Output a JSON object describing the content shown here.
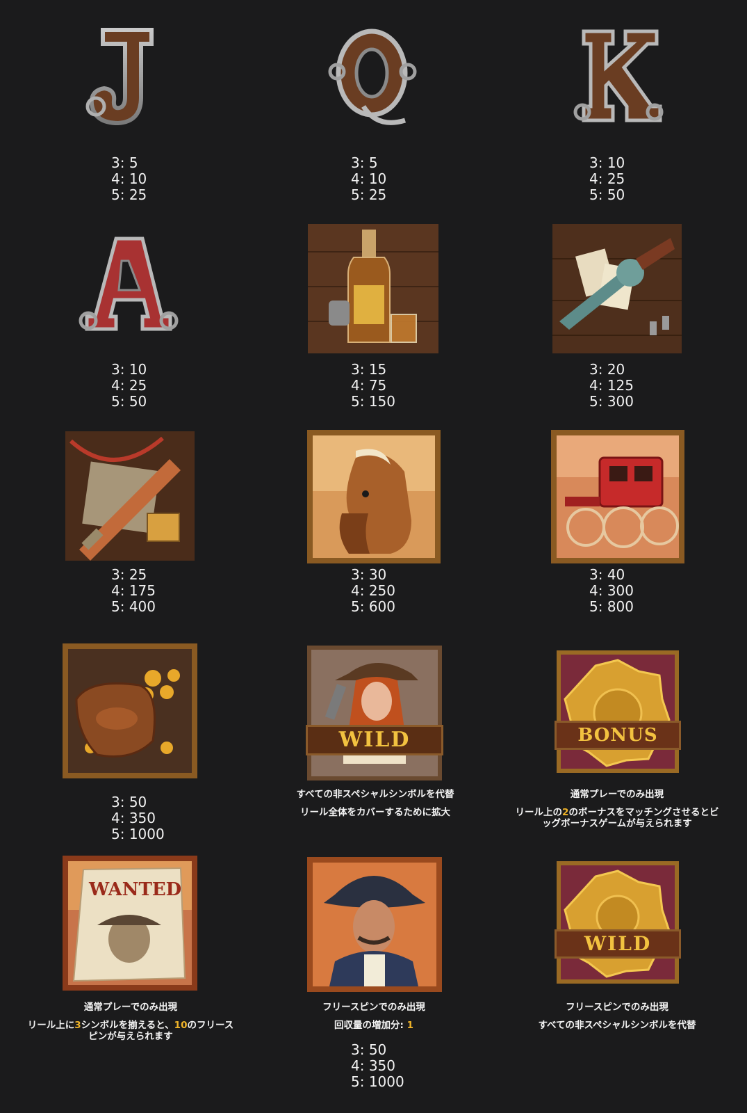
{
  "symbols": [
    {
      "name": "J",
      "payouts": [
        "3: 5",
        "4: 10",
        "5: 25"
      ]
    },
    {
      "name": "Q",
      "payouts": [
        "3: 5",
        "4: 10",
        "5: 25"
      ]
    },
    {
      "name": "K",
      "payouts": [
        "3: 10",
        "4: 25",
        "5: 50"
      ]
    },
    {
      "name": "A",
      "payouts": [
        "3: 10",
        "4: 25",
        "5: 50"
      ]
    },
    {
      "name": "whiskey",
      "payouts": [
        "3: 15",
        "4: 75",
        "5: 150"
      ]
    },
    {
      "name": "revolver",
      "payouts": [
        "3: 20",
        "4: 125",
        "5: 300"
      ]
    },
    {
      "name": "rifle",
      "payouts": [
        "3: 25",
        "4: 175",
        "5: 400"
      ]
    },
    {
      "name": "horse",
      "payouts": [
        "3: 30",
        "4: 250",
        "5: 600"
      ]
    },
    {
      "name": "stagecoach",
      "payouts": [
        "3: 40",
        "4: 300",
        "5: 800"
      ]
    },
    {
      "name": "gold-bag",
      "payouts": [
        "3: 50",
        "4: 350",
        "5: 1000"
      ]
    },
    {
      "name": "wild-woman",
      "label": "WILD",
      "desc": [
        "すべての非スペシャルシンボルを代替",
        "リール全体をカバーするために拡大"
      ]
    },
    {
      "name": "bonus",
      "label": "BONUS",
      "desc1": "通常プレーでのみ出現",
      "desc2_pre": "リール上の",
      "desc2_num": "2",
      "desc2_post": "のボーナスをマッチングさせるとビッグボーナスゲームが与えられます"
    },
    {
      "name": "wanted",
      "label": "WANTED",
      "desc1": "通常プレーでのみ出現",
      "desc2_pre": "リール上に",
      "desc2_num1": "3",
      "desc2_mid": "シンボルを揃えると、",
      "desc2_num2": "10",
      "desc2_post": "のフリースピンが与えられます"
    },
    {
      "name": "sheriff",
      "desc1": "フリースピンでのみ出現",
      "desc2_pre": "回収量の増加分: ",
      "desc2_num": "1",
      "payouts": [
        "3: 50",
        "4: 350",
        "5: 1000"
      ]
    },
    {
      "name": "badge-wild",
      "label": "WILD",
      "desc": [
        "フリースピンでのみ出現",
        "すべての非スペシャルシンボルを代替"
      ]
    }
  ],
  "colors": {
    "highlight": "#f0b429",
    "background": "#1b1b1c"
  }
}
